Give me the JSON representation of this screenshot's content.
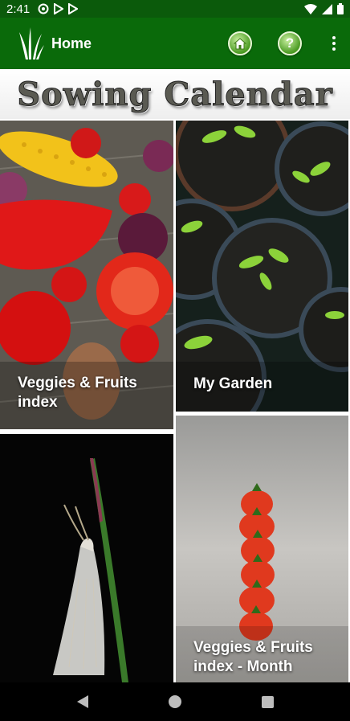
{
  "status": {
    "time": "2:41"
  },
  "appbar": {
    "title": "Home",
    "help_glyph": "?"
  },
  "banner": {
    "title": "Sowing Calendar"
  },
  "tiles": [
    {
      "label": "Veggies & Fruits index"
    },
    {
      "label": "My Garden"
    },
    {
      "label": ""
    },
    {
      "label": "Veggies & Fruits index - Month"
    }
  ],
  "icons": {
    "logo": "grass-logo-icon",
    "home": "home-icon",
    "help": "help-icon",
    "menu": "overflow-menu-icon"
  },
  "colors": {
    "app_bar": "#0a6a0a",
    "status_bar": "#0b5a0b"
  }
}
